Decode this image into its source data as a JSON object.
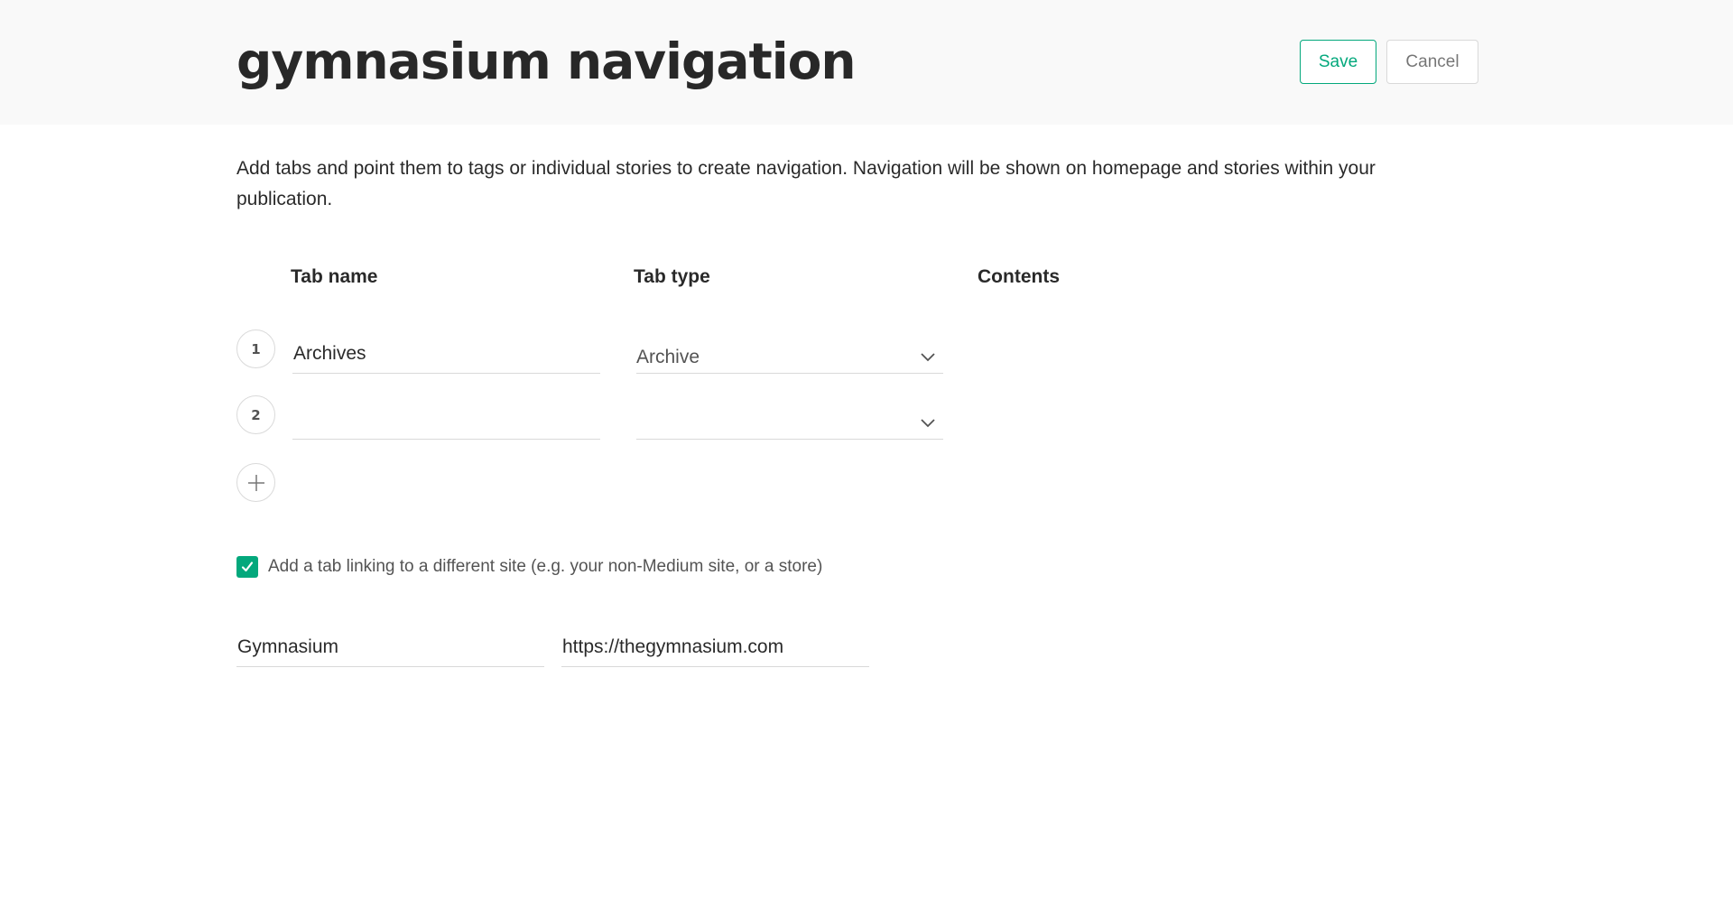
{
  "page": {
    "title": "gymnasium navigation",
    "description": "Add tabs and point them to tags or individual stories to create navigation. Navigation will be shown on homepage and stories within your publication."
  },
  "actions": {
    "save_label": "Save",
    "cancel_label": "Cancel"
  },
  "columns": {
    "tab_name": "Tab name",
    "tab_type": "Tab type",
    "contents": "Contents"
  },
  "tabs": [
    {
      "number": "1",
      "name": "Archives",
      "type": "Archive"
    },
    {
      "number": "2",
      "name": "",
      "type": ""
    }
  ],
  "external_link": {
    "enabled": true,
    "label": "Add a tab linking to a different site (e.g. your non-Medium site, or a store)",
    "name": "Gymnasium",
    "url": "https://thegymnasium.com"
  },
  "colors": {
    "accent": "#03a87c",
    "header_bg": "#f9f9f9"
  },
  "icons": {
    "dropdown": "chevron-down-icon",
    "add": "plus-icon",
    "check": "check-icon"
  }
}
